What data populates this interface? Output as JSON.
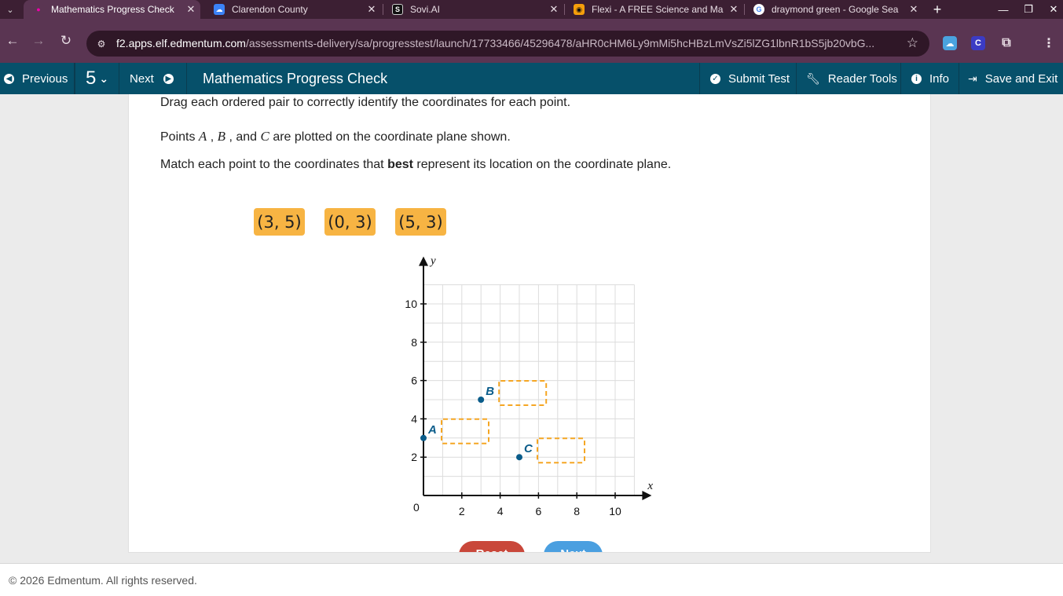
{
  "browser": {
    "tabs": [
      {
        "title": "Mathematics Progress Check",
        "active": true,
        "favicon": "edmentum-icon",
        "color": "#5a3552"
      },
      {
        "title": "Clarendon County",
        "active": false,
        "favicon": "cloud-icon",
        "color": "#3b82f6"
      },
      {
        "title": "Sovi.AI",
        "active": false,
        "favicon": "sovi-icon",
        "color": "#111111"
      },
      {
        "title": "Flexi - A FREE Science and Ma",
        "active": false,
        "favicon": "flexi-icon",
        "color": "#f59e0b"
      },
      {
        "title": "draymond green - Google Sea",
        "active": false,
        "favicon": "google-icon",
        "color": "#ffffff"
      }
    ],
    "url_host": "f2.apps.elf.edmentum.com",
    "url_path": "/assessments-delivery/sa/progresstest/launch/17733466/45296478/aHR0cHM6Ly9mMi5hcHBzLmVsZi5lZG1lbnR1bS5jb20vbG..."
  },
  "appnav": {
    "previous": "Previous",
    "question_number": "5",
    "next": "Next",
    "title": "Mathematics Progress Check",
    "submit": "Submit Test",
    "reader_tools": "Reader Tools",
    "info": "Info",
    "save_exit": "Save and Exit"
  },
  "question": {
    "instruction": "Drag each ordered pair to correctly identify the coordinates for each point.",
    "prompt_start": "Points ",
    "point_a": "A",
    "sep1": " , ",
    "point_b": "B",
    "sep2": " , and ",
    "point_c": "C",
    "prompt_end": " are plotted on the coordinate plane shown.",
    "match_start": "Match each point to the coordinates that ",
    "match_bold": "best",
    "match_end": " represent its location on the coordinate plane.",
    "choices": [
      "(3, 5)",
      "(0, 3)",
      "(5, 3)"
    ]
  },
  "chart_data": {
    "type": "scatter",
    "xlabel": "x",
    "ylabel": "y",
    "xlim": [
      0,
      11
    ],
    "ylim": [
      0,
      11
    ],
    "x_ticks": [
      2,
      4,
      6,
      8,
      10
    ],
    "y_ticks": [
      2,
      4,
      6,
      8,
      10
    ],
    "origin_label": "0",
    "grid": true,
    "points": [
      {
        "label": "A",
        "x": 0,
        "y": 3
      },
      {
        "label": "B",
        "x": 3,
        "y": 5
      },
      {
        "label": "C",
        "x": 5,
        "y": 2
      }
    ],
    "drop_zones": [
      "A",
      "B",
      "C"
    ],
    "point_color": "#0a5c8a",
    "dropzone_color": "#f5a623"
  },
  "buttons": {
    "reset": "Reset",
    "next": "Next",
    "reset_color": "#c9473a",
    "next_color": "#4a9fe0"
  },
  "footer": {
    "copyright": "© 2026 Edmentum. All rights reserved."
  }
}
